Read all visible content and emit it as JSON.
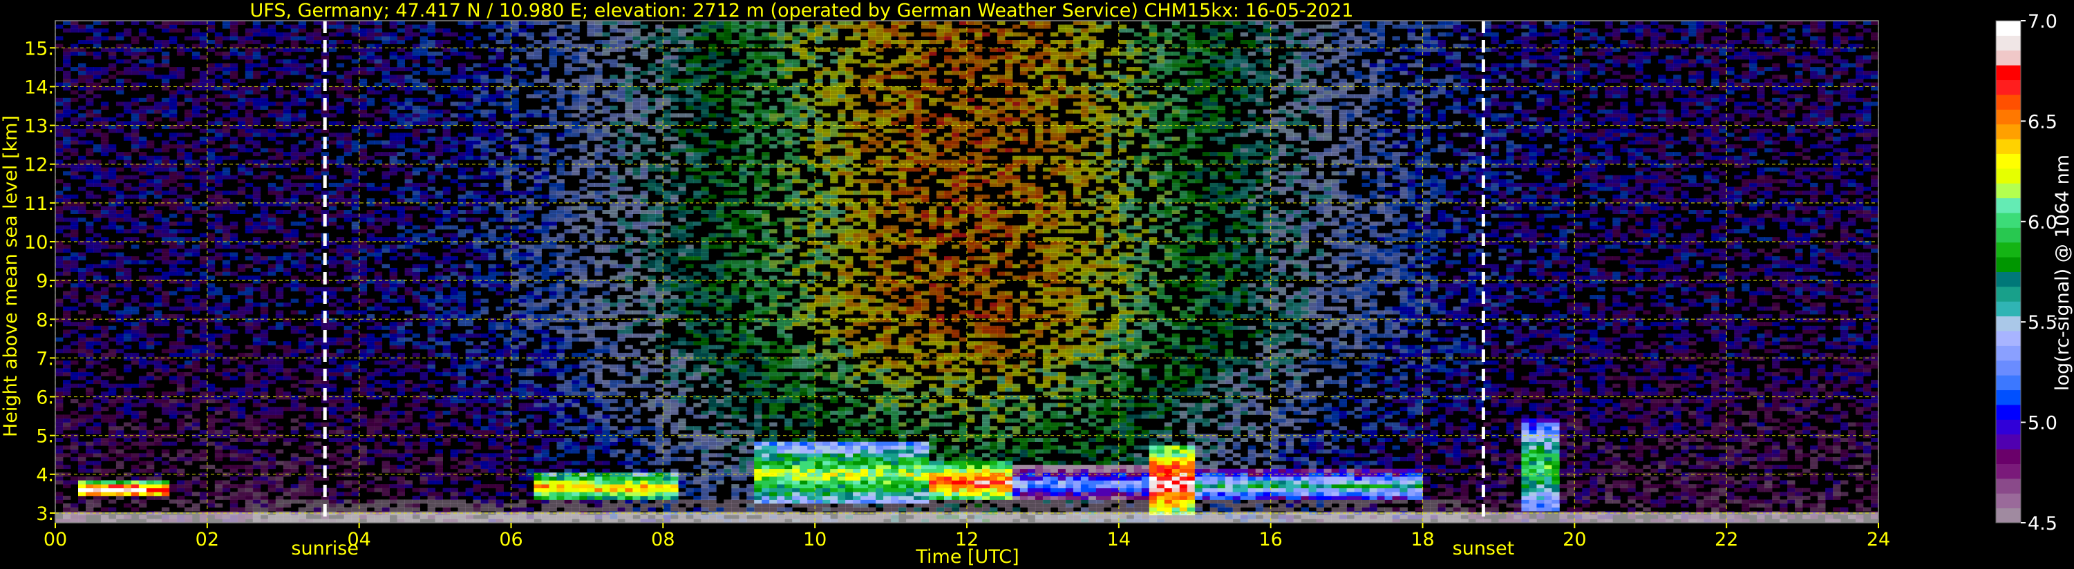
{
  "chart_data": {
    "type": "heatmap",
    "title": "UFS, Germany; 47.417 N / 10.980 E; elevation: 2712 m  (operated by German Weather Service)     CHM15kx: 16-05-2021",
    "xlabel": "Time [UTC]",
    "ylabel": "Height above mean sea level [km]",
    "colorbar_label": "log(rc-signal) @ 1064 nm",
    "xlim": [
      0,
      24
    ],
    "ylim": [
      2.75,
      15.7
    ],
    "x_ticks": [
      0,
      2,
      4,
      6,
      8,
      10,
      12,
      14,
      16,
      18,
      20,
      22,
      24
    ],
    "x_tick_labels": [
      "00",
      "02",
      "04",
      "06",
      "08",
      "10",
      "12",
      "14",
      "16",
      "18",
      "20",
      "22",
      "24"
    ],
    "y_ticks": [
      3,
      4,
      5,
      6,
      7,
      8,
      9,
      10,
      11,
      12,
      13,
      14,
      15
    ],
    "y_tick_labels": [
      "3.",
      "4.",
      "5.",
      "6.",
      "7.",
      "8.",
      "9.",
      "10.",
      "11.",
      "12.",
      "13.",
      "14.",
      "15."
    ],
    "colorbar_range": [
      4.5,
      7.0
    ],
    "colorbar_ticks": [
      4.5,
      5.0,
      5.5,
      6.0,
      6.5,
      7.0
    ],
    "colorbar_tick_labels": [
      "4.5",
      "5.0",
      "5.5",
      "6.0",
      "6.5",
      "7.0"
    ],
    "colorbar_colors": [
      "#a08aa0",
      "#9a6a9a",
      "#8a4a8a",
      "#7a1a7a",
      "#6a006a",
      "#5000b0",
      "#3000d8",
      "#0000ff",
      "#0050ff",
      "#3c78ff",
      "#6a8cff",
      "#8aa0ff",
      "#a8b4ff",
      "#aac8e8",
      "#30b4b4",
      "#18a08a",
      "#007878",
      "#009600",
      "#14b414",
      "#28c850",
      "#3cdc78",
      "#64ebb4",
      "#b4ff50",
      "#e6ff00",
      "#ffff00",
      "#ffd200",
      "#ffa000",
      "#ff7800",
      "#ff5000",
      "#ff1e1e",
      "#ff0000",
      "#f0c8c8",
      "#f0e6e6",
      "#ffffff"
    ],
    "markers": [
      {
        "label": "sunrise",
        "time": 3.55
      },
      {
        "label": "sunset",
        "time": 18.8
      }
    ],
    "grid": true,
    "cloud_layers": [
      {
        "t_start": 6.3,
        "t_end": 8.2,
        "z_base": 3.3,
        "z_top": 4.0,
        "peak": 6.5
      },
      {
        "t_start": 9.2,
        "t_end": 11.5,
        "z_base": 3.2,
        "z_top": 4.8,
        "peak": 6.2
      },
      {
        "t_start": 11.5,
        "t_end": 12.6,
        "z_base": 3.3,
        "z_top": 4.3,
        "peak": 6.7
      },
      {
        "t_start": 12.6,
        "t_end": 14.4,
        "z_base": 3.3,
        "z_top": 4.2,
        "peak": 5.4
      },
      {
        "t_start": 14.4,
        "t_end": 15.0,
        "z_base": 2.9,
        "z_top": 4.7,
        "peak": 6.9
      },
      {
        "t_start": 15.0,
        "t_end": 18.0,
        "z_base": 3.3,
        "z_top": 4.1,
        "peak": 5.7
      },
      {
        "t_start": 19.3,
        "t_end": 19.8,
        "z_base": 3.0,
        "z_top": 5.4,
        "peak": 6.0
      },
      {
        "t_start": 0.3,
        "t_end": 1.5,
        "z_base": 3.4,
        "z_top": 3.8,
        "peak": 6.9
      }
    ]
  }
}
